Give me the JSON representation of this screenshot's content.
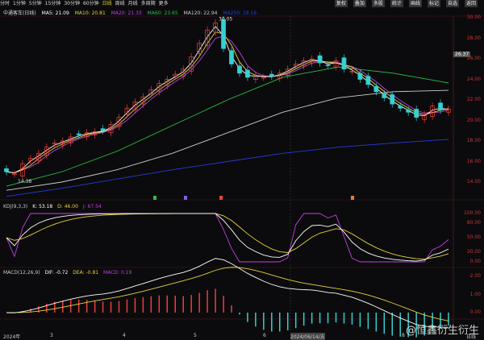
{
  "toolbar": {
    "periods": [
      "分时",
      "1分钟",
      "5分钟",
      "15分钟",
      "30分钟",
      "60分钟",
      "日线",
      "周线",
      "月线",
      "多周期",
      "更多"
    ],
    "active": "日线",
    "tools": [
      "复权",
      "叠加",
      "多股",
      "统计",
      "画线",
      "标记",
      "自选",
      "返回"
    ]
  },
  "info": {
    "name": "中通客车(日线)",
    "ma5": "MA5: 21.09",
    "ma10": "MA10: 20.81",
    "ma20": "MA20: 21.33",
    "ma60": "MA60: 23.65",
    "ma120": "MA120: 22.94",
    "ma250": "MA250: 18.16"
  },
  "kdj": {
    "title": "KDJ(9,3,3)",
    "k": "K: 53.18",
    "d": "D: 46.00",
    "j": "J: 67.54"
  },
  "macd": {
    "title": "MACD(12,26,9)",
    "dif": "DIF: -0.72",
    "dea": "DEA: -0.81",
    "macd": "MACD: 0.19"
  },
  "price_axis": [
    "30.00",
    "28.00",
    "26.00",
    "24.00",
    "22.00",
    "20.00",
    "18.00",
    "16.00",
    "14.00"
  ],
  "current_price": "26.37",
  "high_label": "30.05",
  "low_label": "14.38",
  "kdj_axis": [
    "100.00",
    "80.00",
    "50.00",
    "20.00",
    "0.00"
  ],
  "macd_axis": [
    "2.00",
    "1.00",
    "0.00"
  ],
  "dates": [
    "2024年",
    "3",
    "4",
    "5",
    "6",
    "2024/06/14/五",
    "8",
    "日线"
  ],
  "watermark": "@恒鑫衍生衍生",
  "colors": {
    "up": "#e8413a",
    "down": "#35d0d0",
    "ma5": "#ffffff",
    "ma10": "#e6d33a",
    "ma20": "#c040e0",
    "ma60": "#2fbf4a",
    "ma120": "#cccccc",
    "ma250": "#2a3ad8",
    "axis": "#c33333"
  },
  "chart_data": {
    "type": "candlestick",
    "ylim": [
      13,
      31
    ],
    "close": [
      15.0,
      14.8,
      15.8,
      16.3,
      16.8,
      17.4,
      17.8,
      18.0,
      18.4,
      18.6,
      18.8,
      18.9,
      19.0,
      19.6,
      20.3,
      21.2,
      21.8,
      22.3,
      23.0,
      23.6,
      24.0,
      24.5,
      25.0,
      26.2,
      27.5,
      28.8,
      29.5,
      27.0,
      25.5,
      24.6,
      24.2,
      24.4,
      24.2,
      24.3,
      24.6,
      25.0,
      25.5,
      25.8,
      26.0,
      25.6,
      25.4,
      25.8,
      25.0,
      24.8,
      24.0,
      23.5,
      22.8,
      22.2,
      21.6,
      21.2,
      20.8,
      20.3,
      20.6,
      21.4,
      21.0,
      21.1
    ],
    "ma60": [
      13.6,
      15.0,
      17.0,
      19.5,
      22.0,
      24.2,
      25.2,
      24.6,
      23.65
    ],
    "ma120": [
      13.2,
      14.0,
      15.2,
      16.8,
      18.8,
      20.8,
      22.2,
      22.8,
      22.94
    ],
    "ma250": [
      12.6,
      13.4,
      14.3,
      15.2,
      16.0,
      16.8,
      17.4,
      17.8,
      18.16
    ],
    "high": 30.05,
    "low": 14.38
  }
}
